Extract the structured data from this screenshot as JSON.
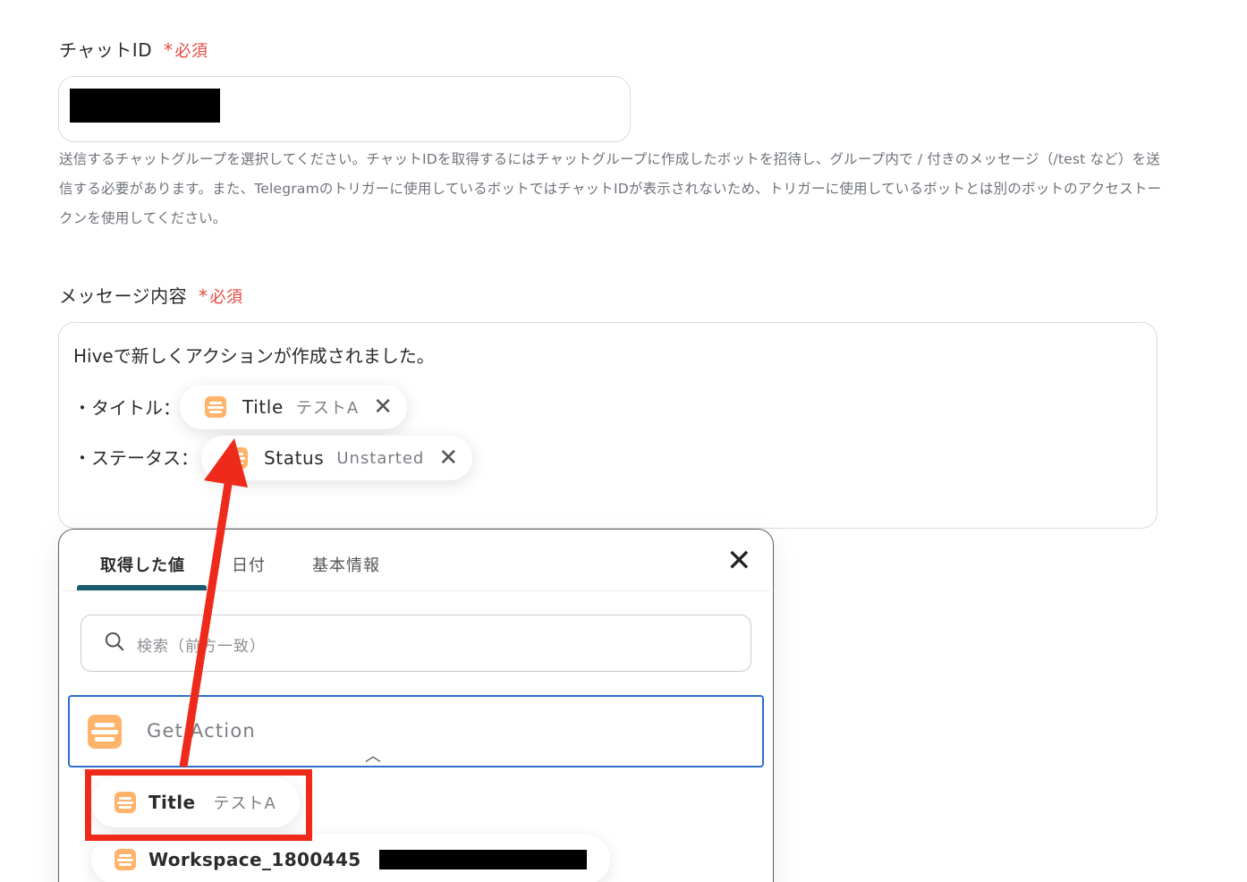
{
  "chat_field": {
    "label": "チャットID",
    "required_star": "*",
    "required_text": "必須",
    "help": "送信するチャットグループを選択してください。チャットIDを取得するにはチャットグループに作成したボットを招待し、グループ内で / 付きのメッセージ（/test など）を送信する必要があります。また、Telegramのトリガーに使用しているボットではチャットIDが表示されないため、トリガーに使用しているボットとは別のボットのアクセストークンを使用してください。"
  },
  "message_field": {
    "label": "メッセージ内容",
    "required_star": "*",
    "required_text": "必須",
    "line1": "Hiveで新しくアクションが作成されました。",
    "title_row_label": "・タイトル：",
    "status_row_label": "・ステータス：",
    "chip_title": {
      "name": "Title",
      "value": "テストA",
      "remove": "✕"
    },
    "chip_status": {
      "name": "Status",
      "value": "Unstarted",
      "remove": "✕"
    }
  },
  "picker": {
    "tabs": [
      "取得した値",
      "日付",
      "基本情報"
    ],
    "active_tab": 0,
    "close": "✕",
    "search_placeholder": "検索（前方一致）",
    "group": {
      "name": "Get Action",
      "chevron": "︿",
      "expanded": true
    },
    "items": [
      {
        "name": "Title",
        "value": "テストA"
      },
      {
        "name": "Workspace_1800445",
        "value": ""
      }
    ]
  },
  "colors": {
    "required": "#e8473f",
    "hive_icon": "#ffb36b",
    "tab_underline": "#1d5b6e",
    "group_border": "#2f6fd0",
    "annotation": "#ee2b1a"
  }
}
